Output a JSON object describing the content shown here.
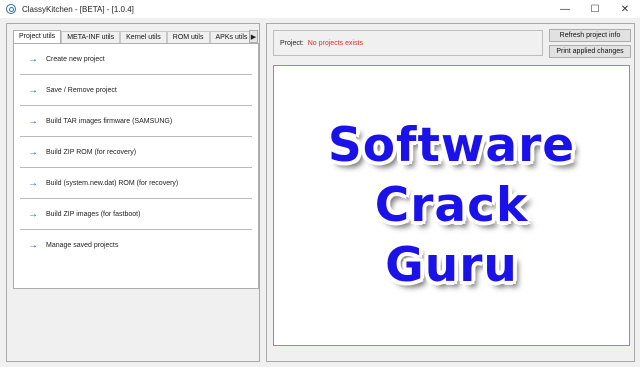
{
  "window": {
    "title": "ClassyKitchen - [BETA] - [1.0.4]",
    "minimize": "—",
    "maximize": "☐",
    "close": "✕"
  },
  "tabs": [
    {
      "label": "Project utils",
      "active": true
    },
    {
      "label": "META-INF utils",
      "active": false
    },
    {
      "label": "Kernel utils",
      "active": false
    },
    {
      "label": "ROM utils",
      "active": false
    },
    {
      "label": "APKs utils",
      "active": false
    }
  ],
  "tab_scroll_icon": "▶",
  "menu": {
    "arrow": "→",
    "items": [
      {
        "label": "Create new project"
      },
      {
        "label": "Save / Remove project"
      },
      {
        "label": "Build TAR images firmware (SAMSUNG)"
      },
      {
        "label": "Build ZIP ROM (for recovery)"
      },
      {
        "label": "Build (system.new.dat) ROM (for recovery)"
      },
      {
        "label": "Build ZIP images (for fastboot)"
      },
      {
        "label": "Manage saved projects"
      }
    ]
  },
  "project": {
    "label": "Project:",
    "value": "No projects exists",
    "value_color": "#e0302b"
  },
  "buttons": {
    "refresh": "Refresh project info",
    "print": "Print applied changes"
  },
  "watermark": {
    "line1": "Software",
    "line2": "Crack",
    "line3": "Guru",
    "color": "#1a12e8"
  }
}
